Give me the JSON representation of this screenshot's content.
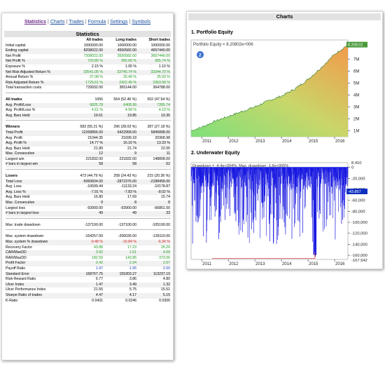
{
  "nav": {
    "items": [
      "Statistics",
      "Charts",
      "Trades",
      "Formula",
      "Settings",
      "Symbols"
    ],
    "active_index": 0,
    "separator": "|"
  },
  "stats": {
    "title": "Statistics",
    "columns": [
      "All trades",
      "Long trades",
      "Short trades"
    ],
    "rows": [
      {
        "label": "Initial capital",
        "v": [
          "1000000.00",
          "1000000.00",
          "1000000.00"
        ]
      },
      {
        "label": "Ending capital",
        "v": [
          "8208022.00",
          "4550582.00",
          "4657440.00"
        ]
      },
      {
        "label": "Net Profit",
        "v": [
          "7208022.00",
          "3550582.00",
          "3657440.00"
        ],
        "color": "green"
      },
      {
        "label": "Net Profit %",
        "v": [
          "720.80 %",
          "355.06 %",
          "365.74 %"
        ],
        "color": "green"
      },
      {
        "label": "Exposure %",
        "v": [
          "2.15 %",
          "1.05 %",
          "1.10 %"
        ]
      },
      {
        "label": "Net Risk Adjusted Return %",
        "v": [
          "33541.05 %",
          "33745.74 %",
          "33344.70 %"
        ],
        "color": "green"
      },
      {
        "label": "Annual Return %",
        "v": [
          "37.08 %",
          "25.49 %",
          "25.93 %"
        ],
        "color": "green"
      },
      {
        "label": "Risk Adjusted Return %",
        "v": [
          "1725.61 %",
          "2422.45 %",
          "2363.58 %"
        ],
        "color": "green"
      },
      {
        "label": "Total transaction costs",
        "v": [
          "729932.00",
          "365144.00",
          "364788.00"
        ]
      },
      {
        "gap": true
      },
      {
        "label": "All trades",
        "v": [
          "1056",
          "554 (52.46 %)",
          "502 (47.54 %)"
        ],
        "bold": true
      },
      {
        "label": " Avg. Profit/Loss",
        "v": [
          "6825.78",
          "6408.99",
          "7285.74"
        ],
        "color": "green"
      },
      {
        "label": " Avg. Profit/Loss %",
        "v": [
          "4.61 %",
          "4.99 %",
          "4.19 %"
        ],
        "color": "green"
      },
      {
        "label": " Avg. Bars Held",
        "v": [
          "19.61",
          "19.85",
          "19.35"
        ]
      },
      {
        "gap": true
      },
      {
        "label": "Winners",
        "v": [
          "583 (55.21 %)",
          "296 (28.03 %)",
          "287 (27.18 %)"
        ],
        "bold": true
      },
      {
        "label": " Total Profit",
        "v": [
          "12268856.00",
          "6422958.00",
          "5845898.00"
        ]
      },
      {
        "label": " Avg. Profit",
        "v": [
          "21044.35",
          "21699.18",
          "20368.98"
        ]
      },
      {
        "label": " Avg. Profit %",
        "v": [
          "14.77 %",
          "16.16 %",
          "13.33 %"
        ]
      },
      {
        "label": " Avg. Bars Held",
        "v": [
          "21.89",
          "21.74",
          "22.05"
        ]
      },
      {
        "label": " Max. Consecutive",
        "v": [
          "12",
          "9",
          "11"
        ]
      },
      {
        "label": " Largest win",
        "v": [
          "221832.00",
          "221832.00",
          "148808.00"
        ]
      },
      {
        "label": " # bars in largest win",
        "v": [
          "58",
          "58",
          "62"
        ]
      },
      {
        "gap": true
      },
      {
        "label": "Losers",
        "v": [
          "473 (44.79 %)",
          "258 (24.43 %)",
          "215 (20.36 %)"
        ],
        "bold": true
      },
      {
        "label": " Total Loss",
        "v": [
          "-5060834.00",
          "-2872376.00",
          "-2188458.00"
        ]
      },
      {
        "label": " Avg. Loss",
        "v": [
          "-10699.44",
          "-11133.24",
          "-10178.87"
        ]
      },
      {
        "label": " Avg. Loss %",
        "v": [
          "-7.91 %",
          "-7.83 %",
          "-8.02 %"
        ]
      },
      {
        "label": " Avg. Bars Held",
        "v": [
          "16.80",
          "17.69",
          "15.74"
        ]
      },
      {
        "label": " Max. Consecutive",
        "v": [
          "9",
          "8",
          "8"
        ]
      },
      {
        "label": " Largest loss",
        "v": [
          "-93900.00",
          "-93900.00",
          "-66861.00"
        ]
      },
      {
        "label": " # bars in largest loss",
        "v": [
          "49",
          "49",
          "33"
        ]
      },
      {
        "gap": true
      },
      {
        "label": "Max. trade drawdown",
        "v": [
          "-137100.00",
          "-137100.00",
          "-105190.00"
        ]
      },
      {
        "gap": true
      },
      {
        "label": "Max. system drawdown",
        "v": [
          "-164257.00",
          "-206035.00",
          "-139119.00"
        ]
      },
      {
        "label": "Max. system % drawdown",
        "v": [
          "-9.48 %",
          "-16.84 %",
          "-6.34 %"
        ],
        "color": "red"
      },
      {
        "label": "Recovery Factor",
        "v": [
          "43.88",
          "17.23",
          "26.29"
        ],
        "color": "green"
      },
      {
        "label": "CAR/MaxDD",
        "v": [
          "3.92",
          "1.51",
          "4.09"
        ],
        "color": "green"
      },
      {
        "label": "RAR/MaxDD",
        "v": [
          "182.59",
          "143.85",
          "373.06"
        ],
        "color": "green"
      },
      {
        "label": "Profit Factor",
        "v": [
          "2.42",
          "2.24",
          "2.67"
        ],
        "color": "green"
      },
      {
        "label": "Payoff Ratio",
        "v": [
          "1.97",
          "1.95",
          "2.00"
        ],
        "color": "blue"
      },
      {
        "label": "Standard Error",
        "v": [
          "168767.75",
          "155303.27",
          "113237.19"
        ]
      },
      {
        "label": "Risk-Reward Ratio",
        "v": [
          "6.77",
          "3.86",
          "4.80"
        ]
      },
      {
        "label": "Ulcer Index",
        "v": [
          "1.47",
          "3.49",
          "1.32"
        ]
      },
      {
        "label": "Ulcer Performance Index",
        "v": [
          "21.55",
          "5.75",
          "15.51"
        ]
      },
      {
        "label": "Sharpe Ratio of trades",
        "v": [
          "4.47",
          "4.17",
          "5.15"
        ]
      },
      {
        "label": "K-Ratio",
        "v": [
          "0.0431",
          "0.0246",
          "0.0306"
        ]
      }
    ]
  },
  "charts": {
    "title": "Charts",
    "equity": {
      "heading": "1. Portfolio Equity",
      "legend": "Portfolio Equity = 8.20802e+006",
      "last_label": "8.208.02",
      "badge": "2"
    },
    "underwater": {
      "heading": "2. Underwater Equity",
      "legend": "Drawdown = -4.4e+004%, Max. drawdown -1.6e+005%",
      "top_label": "8.410",
      "last_label": "-43.857",
      "bottom_label": "-167.542"
    }
  },
  "chart_data": [
    {
      "type": "area",
      "title": "1. Portfolio Equity",
      "x": [
        2010.6,
        2011,
        2011.5,
        2012,
        2012.5,
        2013,
        2013.5,
        2014,
        2014.5,
        2015,
        2015.5,
        2016,
        2016.5
      ],
      "series": [
        {
          "name": "Portfolio Equity",
          "values": [
            1.0,
            1.3,
            1.8,
            2.2,
            2.6,
            3.0,
            3.5,
            3.9,
            4.5,
            5.3,
            6.3,
            7.4,
            8.21
          ]
        }
      ],
      "x_ticks": [
        "2011",
        "2012",
        "2013",
        "2014",
        "2015",
        "2016"
      ],
      "y_ticks": [
        "1M",
        "2M",
        "3M",
        "4M",
        "5M",
        "6M",
        "7M"
      ],
      "ylim": [
        0.5,
        8.6
      ],
      "y_unit": "M"
    },
    {
      "type": "area",
      "title": "2. Underwater Equity",
      "x": [
        2010.6,
        2011,
        2011.5,
        2012,
        2012.5,
        2013,
        2013.5,
        2014,
        2014.5,
        2015,
        2015.5,
        2016,
        2016.5
      ],
      "series": [
        {
          "name": "Drawdown",
          "values": [
            0,
            -120000,
            -60000,
            -90000,
            -100000,
            -70000,
            -130000,
            -80000,
            -100000,
            -110000,
            -120000,
            -90000,
            -43857
          ]
        }
      ],
      "x_ticks": [
        "2011",
        "2012",
        "2013",
        "2014",
        "2015",
        "2016"
      ],
      "y_ticks": [
        "0",
        "-20,000",
        "-40,000",
        "-60,000",
        "-80,000",
        "-100,000",
        "-120,000",
        "-140,000",
        "-160,000"
      ],
      "ylim": [
        -167542,
        8410
      ]
    }
  ]
}
